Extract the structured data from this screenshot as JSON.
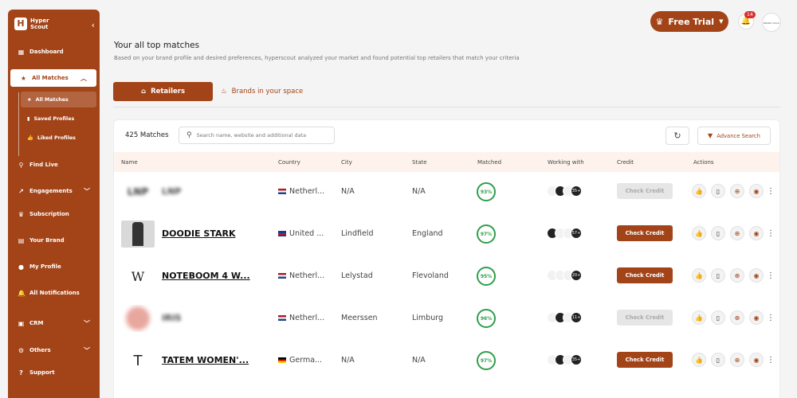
{
  "app": {
    "logo_text_1": "Hyper",
    "logo_text_2": "Scout"
  },
  "sidebar": {
    "items": [
      {
        "label": "Dashboard",
        "icon": "dashboard-icon"
      },
      {
        "label": "All Matches",
        "icon": "star-icon",
        "active": true
      },
      {
        "label": "Find Live",
        "icon": "location-pin-icon"
      },
      {
        "label": "Engagements",
        "icon": "chart-line-icon"
      },
      {
        "label": "Subscription",
        "icon": "crown-icon"
      },
      {
        "label": "Your Brand",
        "icon": "id-card-icon"
      },
      {
        "label": "My Profile",
        "icon": "user-icon"
      },
      {
        "label": "All Notifications",
        "icon": "bell-icon"
      },
      {
        "label": "CRM",
        "icon": "briefcase-icon"
      },
      {
        "label": "Others",
        "icon": "gear-icon"
      },
      {
        "label": "Support",
        "icon": "help-icon"
      }
    ],
    "sub_items": [
      {
        "label": "All Matches",
        "active": true
      },
      {
        "label": "Saved Profiles"
      },
      {
        "label": "Liked Profiles"
      }
    ]
  },
  "topbar": {
    "trial_label": "Free Trial",
    "notification_count": "14",
    "avatar_text": "BRAND LOGO"
  },
  "header": {
    "title": "Your all top matches",
    "subtitle": "Based on your brand profile and desired preferences, hyperscout analyzed your market and found potential top retailers that match your criteria"
  },
  "tabs": {
    "retailers": "Retailers",
    "brands": "Brands in your space"
  },
  "toolbar": {
    "matches_count": "425 Matches",
    "search_placeholder": "Search name, website and additional data",
    "advance_search": "Advance Search"
  },
  "table": {
    "columns": [
      "Name",
      "Country",
      "City",
      "State",
      "Matched",
      "Working with",
      "Credit",
      "Actions"
    ],
    "rows": [
      {
        "name": "LNP",
        "country": "Netherl...",
        "flag": "nl",
        "city": "N/A",
        "state": "N/A",
        "matched": "93%",
        "working_count": "35+",
        "credit": "Check Credit",
        "credit_enabled": false,
        "blurred": true
      },
      {
        "name": "DOODIE STARK",
        "country": "United ...",
        "flag": "uk",
        "city": "Lindfield",
        "state": "England",
        "matched": "97%",
        "working_count": "57+",
        "credit": "Check Credit",
        "credit_enabled": true,
        "blurred": false
      },
      {
        "name": "NOTEBOOM 4 W...",
        "country": "Netherl...",
        "flag": "nl",
        "city": "Lelystad",
        "state": "Flevoland",
        "matched": "95%",
        "working_count": "20+",
        "credit": "Check Credit",
        "credit_enabled": true,
        "blurred": false
      },
      {
        "name": "IRIS",
        "country": "Netherl...",
        "flag": "nl",
        "city": "Meerssen",
        "state": "Limburg",
        "matched": "96%",
        "working_count": "11+",
        "credit": "Check Credit",
        "credit_enabled": false,
        "blurred": true
      },
      {
        "name": "TATEM WOMEN'...",
        "country": "Germa...",
        "flag": "de",
        "city": "N/A",
        "state": "N/A",
        "matched": "97%",
        "working_count": "35+",
        "credit": "Check Credit",
        "credit_enabled": true,
        "blurred": false
      }
    ]
  },
  "colors": {
    "brand": "#a34418",
    "success": "#2e9e4a",
    "header_bg": "#fdf3ec"
  }
}
